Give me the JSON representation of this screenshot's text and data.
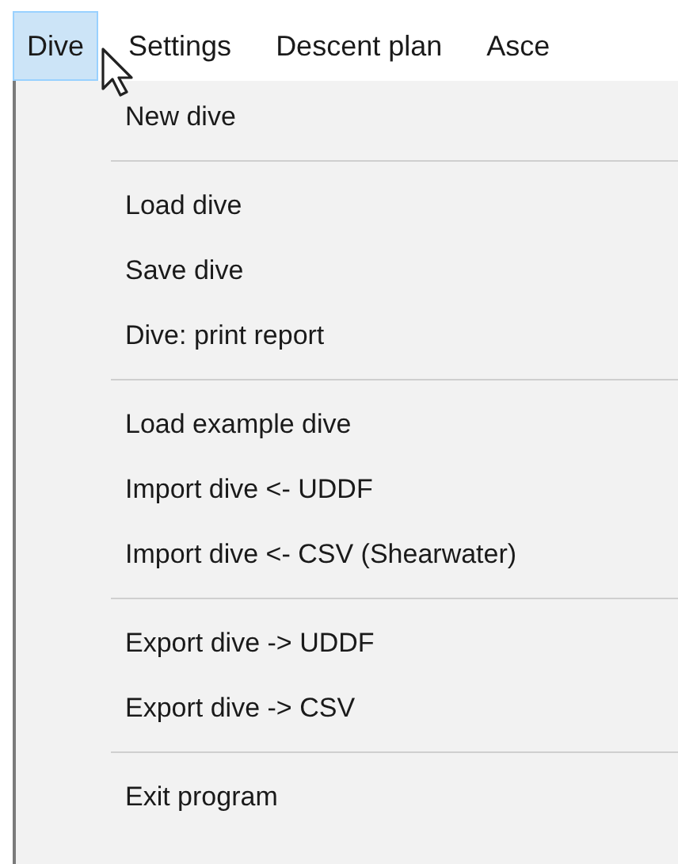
{
  "menu_bar": [
    {
      "label": "Dive",
      "selected": true
    },
    {
      "label": "Settings",
      "selected": false
    },
    {
      "label": "Descent plan",
      "selected": false
    },
    {
      "label": "Asce",
      "selected": false
    }
  ],
  "dropdown": [
    {
      "kind": "item",
      "label": "New dive"
    },
    {
      "kind": "separator"
    },
    {
      "kind": "item",
      "label": "Load dive"
    },
    {
      "kind": "item",
      "label": "Save dive"
    },
    {
      "kind": "item",
      "label": "Dive: print report"
    },
    {
      "kind": "separator"
    },
    {
      "kind": "item",
      "label": "Load example dive"
    },
    {
      "kind": "item",
      "label": "Import dive <- UDDF"
    },
    {
      "kind": "item",
      "label": "Import dive <- CSV (Shearwater)"
    },
    {
      "kind": "separator"
    },
    {
      "kind": "item",
      "label": "Export dive -> UDDF"
    },
    {
      "kind": "item",
      "label": "Export dive -> CSV"
    },
    {
      "kind": "separator"
    },
    {
      "kind": "item",
      "label": "Exit program"
    }
  ]
}
